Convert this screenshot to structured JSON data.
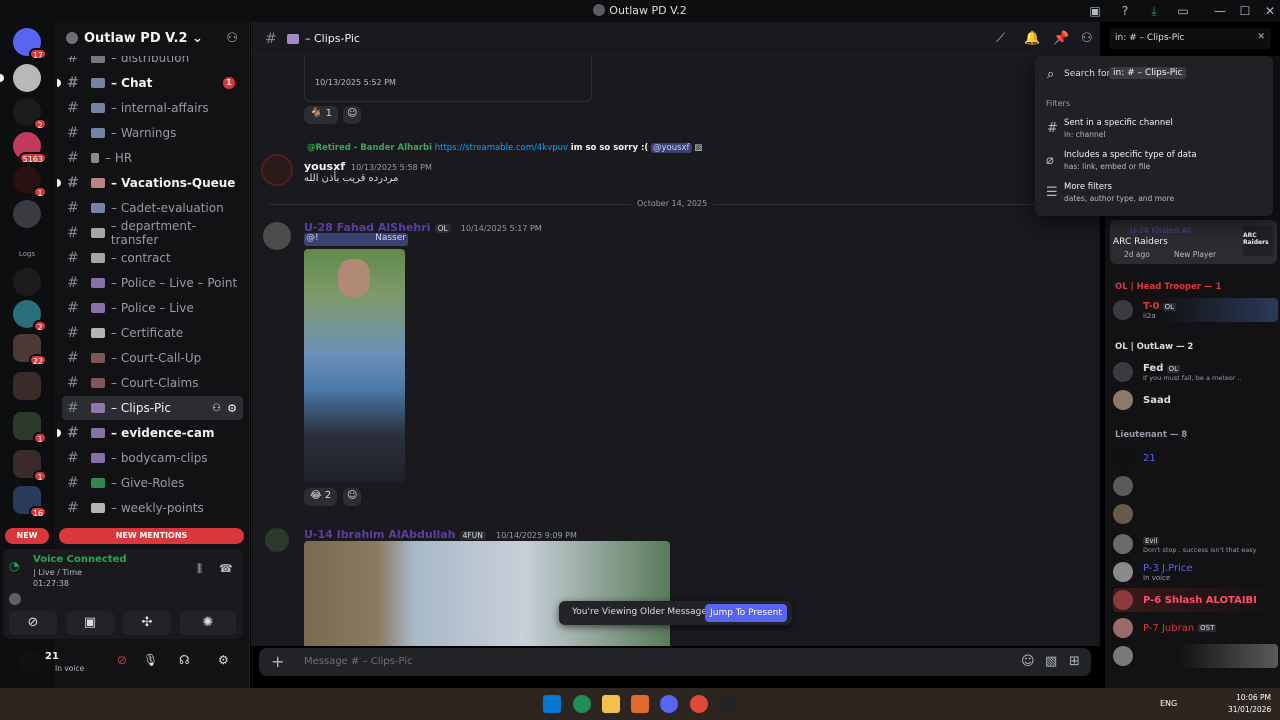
{
  "window": {
    "title": "Outlaw PD V.2",
    "controls": [
      "—",
      "☐",
      "✕"
    ]
  },
  "servers": [
    {
      "badge": "17"
    },
    {
      "badge": ""
    },
    {
      "badge": "2"
    },
    {
      "badge": "5163"
    },
    {
      "badge": "1"
    },
    {
      "badge": ""
    },
    {
      "badge": ""
    },
    {
      "badge": ""
    },
    {
      "badge": "2"
    },
    {
      "badge": "22"
    },
    {
      "badge": ""
    },
    {
      "badge": "1"
    },
    {
      "badge": "1"
    },
    {
      "badge": "16"
    }
  ],
  "rail_labels": {
    "logo": "Logs",
    "new": "NEW"
  },
  "sidebar": {
    "server_name": "Outlaw PD V.2",
    "channels": [
      {
        "label": "– distribution",
        "state": "normal"
      },
      {
        "label": "– Chat",
        "state": "unread",
        "badge": "1"
      },
      {
        "label": "– internal-affairs",
        "state": "normal"
      },
      {
        "label": "– Warnings",
        "state": "normal"
      },
      {
        "label": "– HR",
        "state": "normal"
      },
      {
        "label": "– Vacations-Queue",
        "state": "unread"
      },
      {
        "label": "– Cadet-evaluation",
        "state": "normal"
      },
      {
        "label": "– department-transfer",
        "state": "normal"
      },
      {
        "label": "– contract",
        "state": "normal"
      },
      {
        "label": "– Police – Live – Point",
        "state": "normal"
      },
      {
        "label": "– Police – Live",
        "state": "normal"
      },
      {
        "label": "– Certificate",
        "state": "normal"
      },
      {
        "label": "– Court-Call-Up",
        "state": "normal"
      },
      {
        "label": "– Court-Claims",
        "state": "normal"
      },
      {
        "label": "– Clips-Pic",
        "state": "active"
      },
      {
        "label": "– evidence-cam",
        "state": "unread"
      },
      {
        "label": "– bodycam-clips",
        "state": "normal"
      },
      {
        "label": "– Give-Roles",
        "state": "normal"
      },
      {
        "label": "– weekly-points",
        "state": "normal"
      }
    ],
    "new_mentions": "NEW MENTIONS",
    "voice": {
      "status": "Voice Connected",
      "channel": "| Live / Time",
      "timer": "01:27:38"
    },
    "user": {
      "name": "21",
      "status": "In voice"
    }
  },
  "chat": {
    "channel_name": "– Clips-Pic",
    "messages": [
      {
        "id": "m0",
        "time": "10/13/2025 5:52 PM",
        "reaction_count": "1"
      },
      {
        "id": "m1",
        "reply_author": "@Retired - Bander Alharbi",
        "reply_link": "https://streamable.com/4kvpuv",
        "reply_text": "im so so sorry :(",
        "reply_mention": "@yousxf",
        "author": "yousxf",
        "time": "10/13/2025 5:58 PM",
        "text": "مردرده قريب بأذن الله"
      },
      {
        "id": "m2",
        "author": "U-28 Fahad AlShehri",
        "tag": "OL",
        "time": "10/14/2025 5:17 PM",
        "mention": "@!",
        "mention_name": "Nasser",
        "reaction_count": "2"
      },
      {
        "id": "m3",
        "author": "U-14 Ibrahim AlAbdullah",
        "tag": "4FUN",
        "time": "10/14/2025 9:09 PM"
      }
    ],
    "date_divider": "October 14, 2025",
    "older_banner": "You're Viewing Older Messages",
    "jump_button": "Jump To Present",
    "composer_placeholder": "Message # – Clips-Pic"
  },
  "search": {
    "query": "in: # – Clips-Pic",
    "search_for": "Search for",
    "query_token": "in: # – Clips-Pic",
    "filters_label": "Filters",
    "options": [
      {
        "title": "Sent in a specific channel",
        "sub": "in: channel",
        "icon": "hash-icon"
      },
      {
        "title": "Includes a specific type of data",
        "sub": "has: link, embed or file",
        "icon": "link-icon"
      },
      {
        "title": "More filters",
        "sub": "dates, author type, and more",
        "icon": "sliders-icon"
      }
    ]
  },
  "members": {
    "activity": {
      "name": "U-24 Khaled Ali",
      "game": "ARC Raiders",
      "time": "2d ago",
      "label": "New Player",
      "logo": "ARC Raiders"
    },
    "groups": [
      {
        "title": "OL | Head Trooper — 1",
        "color": "#da373c"
      },
      {
        "title": "OL | OutLaw — 2",
        "color": "#dbdee1"
      },
      {
        "title": "Lieutenant — 8",
        "color": "#949ba4"
      }
    ],
    "list": [
      {
        "name": "T-0",
        "tag": "OL",
        "sub": "ii2a",
        "color": "#da373c"
      },
      {
        "name": "Fed",
        "tag": "OL",
        "sub": "If you must fall, be a meteor ..",
        "color": "#dbdee1"
      },
      {
        "name": "Saad",
        "color": "#dbdee1"
      },
      {
        "name": "21",
        "color": "#5865f2"
      },
      {
        "name": "",
        "color": "#dbdee1"
      },
      {
        "name": "",
        "color": "#dbdee1"
      },
      {
        "name": "Evil",
        "sub": "Don't stop , success isn't that easy",
        "color": "#dbdee1"
      },
      {
        "name": "P-3 J.Price",
        "sub": "In voice",
        "color": "#5865f2"
      },
      {
        "name": "P-6 Shlash ALOTAIBI",
        "color": "#ff4d6d"
      },
      {
        "name": "P-7 Jubran",
        "tag": "OST",
        "color": "#da373c"
      },
      {
        "name": "",
        "color": "#dbdee1"
      }
    ]
  },
  "taskbar": {
    "lang": "ENG",
    "time": "10:06 PM",
    "date": "31/01/2026"
  }
}
